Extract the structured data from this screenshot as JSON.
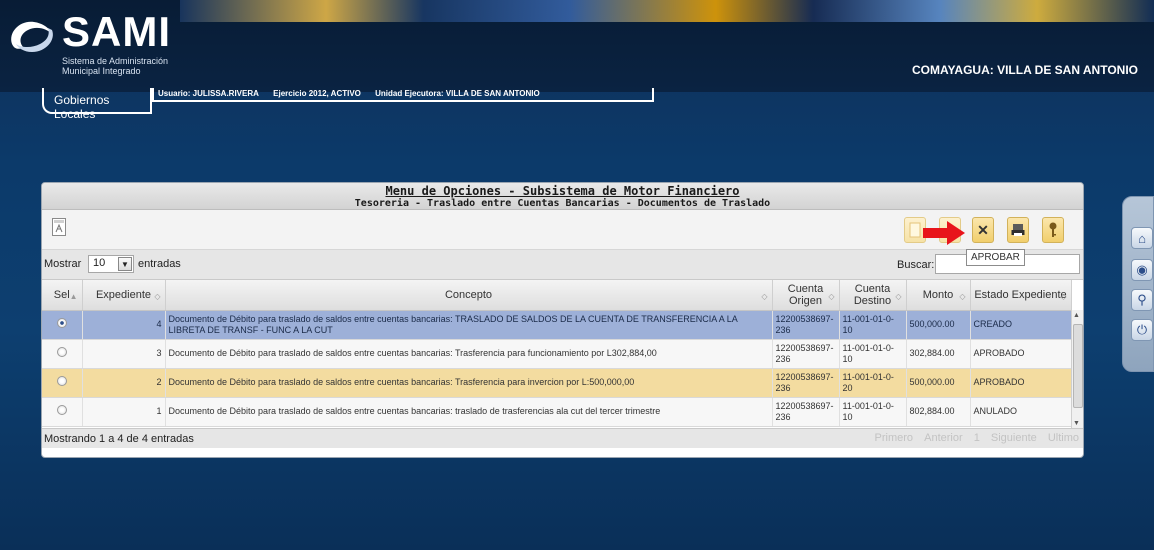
{
  "header": {
    "logo_title": "SAMI",
    "logo_subtitle_1": "Sistema de Administración",
    "logo_subtitle_2": "Municipal Integrado",
    "municipality": "COMAYAGUA: VILLA DE SAN ANTONIO",
    "tab_label": "Gobiernos Locales",
    "user": "Usuario: JULISSA.RIVERA",
    "exercise": "Ejercicio 2012, ACTIVO",
    "unit": "Unidad Ejecutora: VILLA DE SAN ANTONIO"
  },
  "panel": {
    "title": "Menu de Opciones - Subsistema de Motor Financiero",
    "subtitle": "Tesoreria - Traslado entre Cuentas Bancarias - Documentos de Traslado",
    "tooltip": "APROBAR"
  },
  "controls": {
    "show_label": "Mostrar",
    "page_size": "10",
    "entries_label": "entradas",
    "search_label": "Buscar:"
  },
  "table": {
    "headers": [
      "Sel",
      "Expediente",
      "Concepto",
      "Cuenta Origen",
      "Cuenta Destino",
      "Monto",
      "Estado Expediente"
    ],
    "rows": [
      {
        "selected": true,
        "expediente": "4",
        "concepto": "Documento de Débito para traslado de saldos entre cuentas bancarias: TRASLADO DE SALDOS DE LA CUENTA DE TRANSFERENCIA A LA LIBRETA DE TRANSF - FUNC A LA CUT",
        "origen": "12200538697-236",
        "destino": "11-001-01-0-10",
        "monto": "500,000.00",
        "estado": "CREADO"
      },
      {
        "selected": false,
        "expediente": "3",
        "concepto": "Documento de Débito para traslado de saldos entre cuentas bancarias: Trasferencia para funcionamiento por L302,884,00",
        "origen": "12200538697-236",
        "destino": "11-001-01-0-10",
        "monto": "302,884.00",
        "estado": "APROBADO"
      },
      {
        "selected": false,
        "expediente": "2",
        "concepto": "Documento de Débito para traslado de saldos entre cuentas bancarias: Trasferencia para invercion por L:500,000,00",
        "origen": "12200538697-236",
        "destino": "11-001-01-0-20",
        "monto": "500,000.00",
        "estado": "APROBADO"
      },
      {
        "selected": false,
        "expediente": "1",
        "concepto": "Documento de Débito para traslado de saldos entre cuentas bancarias: traslado de trasferencias ala cut del tercer trimestre",
        "origen": "12200538697-236",
        "destino": "11-001-01-0-10",
        "monto": "802,884.00",
        "estado": "ANULADO"
      }
    ]
  },
  "footer": {
    "info": "Mostrando 1 a 4 de 4 entradas",
    "first": "Primero",
    "prev": "Anterior",
    "page": "1",
    "next": "Siguiente",
    "last": "Ultimo"
  },
  "icons": {
    "toolbar": [
      "new-document-icon",
      "edit-icon",
      "close-icon",
      "print-icon",
      "key-icon"
    ],
    "dock": [
      "home-icon",
      "eye-icon",
      "ribbon-icon",
      "power-icon"
    ]
  },
  "colors": {
    "selected_row": "#9db0d8",
    "highlight_row": "#f3dca0",
    "arrow": "#e8141b"
  }
}
